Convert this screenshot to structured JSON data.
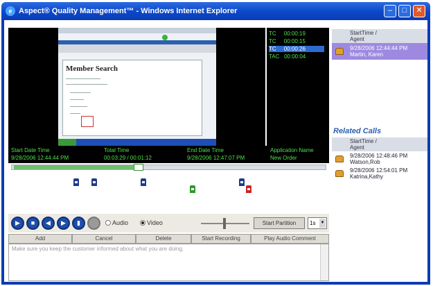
{
  "window": {
    "title": "Aspect® Quality Management™ - Windows Internet Explorer",
    "ie_glyph": "e",
    "minimize_icon": "minimize-icon",
    "maximize_icon": "maximize-icon",
    "close_icon": "close-icon"
  },
  "screen": {
    "heading": "Member Search"
  },
  "counters": [
    {
      "label": "TC",
      "value": "00:00:19"
    },
    {
      "label": "TC",
      "value": "00:00:15"
    },
    {
      "label": "TC",
      "value": "00:00:26"
    },
    {
      "label": "TAC",
      "value": "00:00:04"
    }
  ],
  "info": {
    "start_label": "Start Date Time",
    "start_value": "9/28/2006 12:44:44 PM",
    "total_label": "Total Time",
    "total_value": "00:03:29 / 00:01:12",
    "end_label": "End Date Time",
    "end_value": "9/28/2006 12:47:07 PM",
    "app_label": "Application Name",
    "app_value": "New Order"
  },
  "timeline": {
    "progress": 0.42
  },
  "controls": {
    "play_icon": "play-icon",
    "stop_icon": "stop-icon",
    "rewind_icon": "rewind-icon",
    "forward_icon": "forward-icon",
    "skip_icon": "skip-icon",
    "record_icon": "record-icon",
    "audio_label": "Audio",
    "video_label": "Video",
    "start_partition": "Start Partition",
    "select_value": "1s"
  },
  "actions": {
    "add": "Add",
    "cancel": "Cancel",
    "delete": "Delete",
    "start_recording": "Start Recording",
    "play_audio": "Play Audio Comment"
  },
  "comment": {
    "text": "Make sure you keep the customer informed about what you are doing."
  },
  "right": {
    "header1_line1": "StartTime /",
    "header1_line2": "Agent",
    "current_time": "9/28/2006 12:44:44 PM",
    "current_agent": "Martin, Karen",
    "related_title": "Related Calls",
    "header2_line1": "StartTime /",
    "header2_line2": "Agent",
    "related": [
      {
        "time": "9/28/2006 12:48:46 PM",
        "agent": "Watson,Rob"
      },
      {
        "time": "9/28/2006 12:54:01 PM",
        "agent": "Katrina,Kathy"
      }
    ]
  },
  "colors": {
    "accent": "#0d47c8",
    "counter_text": "#4ee04e",
    "selection": "#9d8ae0"
  }
}
